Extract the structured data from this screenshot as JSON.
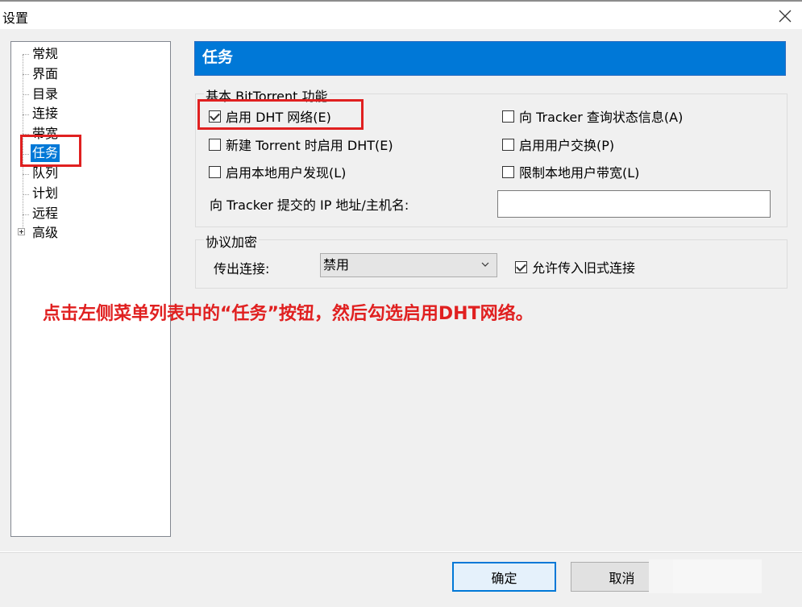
{
  "window": {
    "title": "设置"
  },
  "sidebar": {
    "items": [
      {
        "label": "常规",
        "selected": false
      },
      {
        "label": "界面",
        "selected": false
      },
      {
        "label": "目录",
        "selected": false
      },
      {
        "label": "连接",
        "selected": false
      },
      {
        "label": "带宽",
        "selected": false
      },
      {
        "label": "任务",
        "selected": true
      },
      {
        "label": "队列",
        "selected": false
      },
      {
        "label": "计划",
        "selected": false
      },
      {
        "label": "远程",
        "selected": false
      },
      {
        "label": "高级",
        "selected": false,
        "expandable": true
      }
    ]
  },
  "main": {
    "header": "任务",
    "bittorrent_group": {
      "title": "基本 BitTorrent 功能",
      "options": [
        {
          "label": "启用 DHT 网络(E)",
          "checked": true
        },
        {
          "label": "向 Tracker 查询状态信息(A)",
          "checked": false
        },
        {
          "label": "新建 Torrent 时启用 DHT(E)",
          "checked": false
        },
        {
          "label": "启用用户交换(P)",
          "checked": false
        },
        {
          "label": "启用本地用户发现(L)",
          "checked": false
        },
        {
          "label": "限制本地用户带宽(L)",
          "checked": false
        }
      ],
      "tracker_ip_label": "向 Tracker 提交的 IP 地址/主机名:",
      "tracker_ip_value": ""
    },
    "encryption_group": {
      "title": "协议加密",
      "outgoing_label": "传出连接:",
      "outgoing_value": "禁用",
      "allow_legacy_label": "允许传入旧式连接",
      "allow_legacy_checked": true
    }
  },
  "annotation": {
    "text": "点击左侧菜单列表中的“任务”按钮，然后勾选启用DHT网络。",
    "color": "#e02020"
  },
  "footer": {
    "ok_label": "确定",
    "cancel_label": "取消"
  },
  "colors": {
    "accent": "#0078d7",
    "annotation_red": "#e02020"
  }
}
